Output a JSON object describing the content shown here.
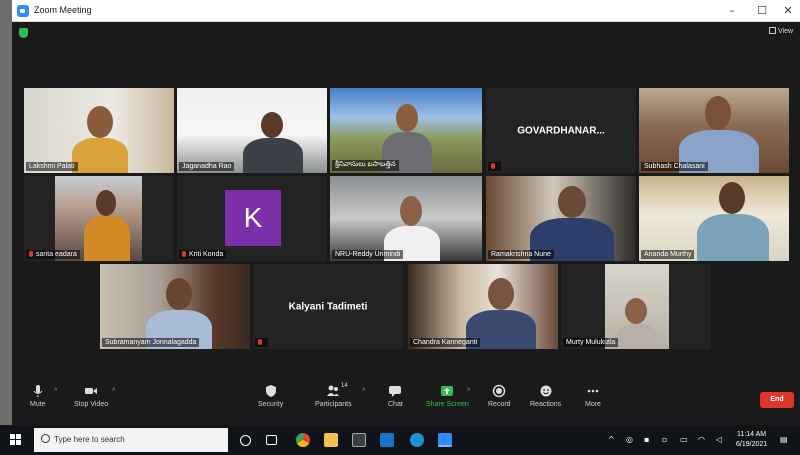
{
  "window": {
    "title": "Zoom Meeting",
    "minimize": "–",
    "maximize": "☐",
    "close": "✕",
    "view_label": "View"
  },
  "participants": [
    {
      "id": "lakshmi",
      "name": "Lakshmi Palati",
      "muted": false
    },
    {
      "id": "jaganadha",
      "name": "Jaganadha Rao",
      "muted": false
    },
    {
      "id": "telugu",
      "name": "శ్రీనివాసులు బసాబత్తిన",
      "muted": false
    },
    {
      "id": "govardhan",
      "name": "",
      "tile_text": "GOVARDHANAR...",
      "muted": true
    },
    {
      "id": "subhash",
      "name": "Subhash Chalasani",
      "muted": false
    },
    {
      "id": "sarita",
      "name": "sarita eadara",
      "muted": true
    },
    {
      "id": "kriti",
      "name": "Kriti Konda",
      "muted": true,
      "avatar_letter": "K"
    },
    {
      "id": "nru",
      "name": "NRU-Reddy Urimindi",
      "muted": false,
      "active": true
    },
    {
      "id": "ramakrishna",
      "name": "Ramakrishna Nune",
      "muted": false
    },
    {
      "id": "ananda",
      "name": "Ananda Murthy",
      "muted": false
    },
    {
      "id": "subramanyam",
      "name": "Subramanyam Jonnalagadda",
      "muted": false
    },
    {
      "id": "kalyani",
      "name": "",
      "tile_text": "Kalyani Tadimeti",
      "muted": true
    },
    {
      "id": "chandra",
      "name": "Chandra Kanneganti",
      "muted": false
    },
    {
      "id": "murty",
      "name": "Murty Mulukutla",
      "muted": false
    }
  ],
  "toolbar": {
    "mute": "Mute",
    "stop_video": "Stop Video",
    "security": "Security",
    "participants": "Participants",
    "participants_count": "14",
    "chat": "Chat",
    "share_screen": "Share Screen",
    "record": "Record",
    "reactions": "Reactions",
    "more": "More",
    "end": "End"
  },
  "taskbar": {
    "search_placeholder": "Type here to search",
    "time": "11:14 AM",
    "date": "6/19/2021"
  },
  "colors": {
    "accent_green": "#2fbf50",
    "end_red": "#e0342b",
    "active_speaker": "#c6e04a",
    "avatar_purple": "#7b2fa8"
  }
}
